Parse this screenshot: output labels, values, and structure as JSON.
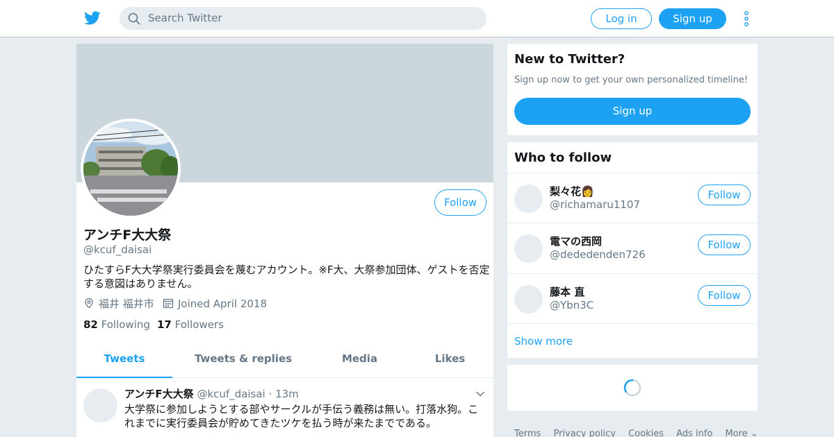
{
  "header": {
    "search_placeholder": "Search Twitter",
    "login_label": "Log in",
    "signup_label": "Sign up",
    "accent": "#1da1f2"
  },
  "profile": {
    "follow_label": "Follow",
    "name": "アンチF大大祭",
    "handle": "@kcuf_daisai",
    "bio": "ひたすらF大大学祭実行委員会を蔑むアカウント。※F大、大祭参加団体、ゲストを否定する意図はありません。",
    "location": "福井 福井市",
    "joined": "Joined April 2018",
    "following_count": "82",
    "following_label": "Following",
    "followers_count": "17",
    "followers_label": "Followers",
    "tabs": [
      {
        "label": "Tweets",
        "active": true
      },
      {
        "label": "Tweets & replies",
        "active": false
      },
      {
        "label": "Media",
        "active": false
      },
      {
        "label": "Likes",
        "active": false
      }
    ]
  },
  "tweet": {
    "name": "アンチF大大祭",
    "handle": "@kcuf_daisai",
    "separator": "·",
    "time": "13m",
    "text": "大学祭に参加しようとする部やサークルが手伝う義務は無い。打落水狗。これまでに実行委員会が貯めてきたツケを払う時が来たまでである。"
  },
  "new_to_twitter": {
    "title": "New to Twitter?",
    "subtitle": "Sign up now to get your own personalized timeline!",
    "button": "Sign up"
  },
  "who_to_follow": {
    "title": "Who to follow",
    "users": [
      {
        "name": "梨々花👩",
        "handle": "@richamaru1107",
        "button": "Follow"
      },
      {
        "name": "電マの西岡",
        "handle": "@dededenden726",
        "button": "Follow"
      },
      {
        "name": "藤本 直",
        "handle": "@Ybn3C",
        "button": "Follow"
      }
    ],
    "show_more": "Show more"
  },
  "footer": {
    "links": [
      "Terms",
      "Privacy policy",
      "Cookies",
      "Ads info",
      "More ⌄"
    ]
  }
}
